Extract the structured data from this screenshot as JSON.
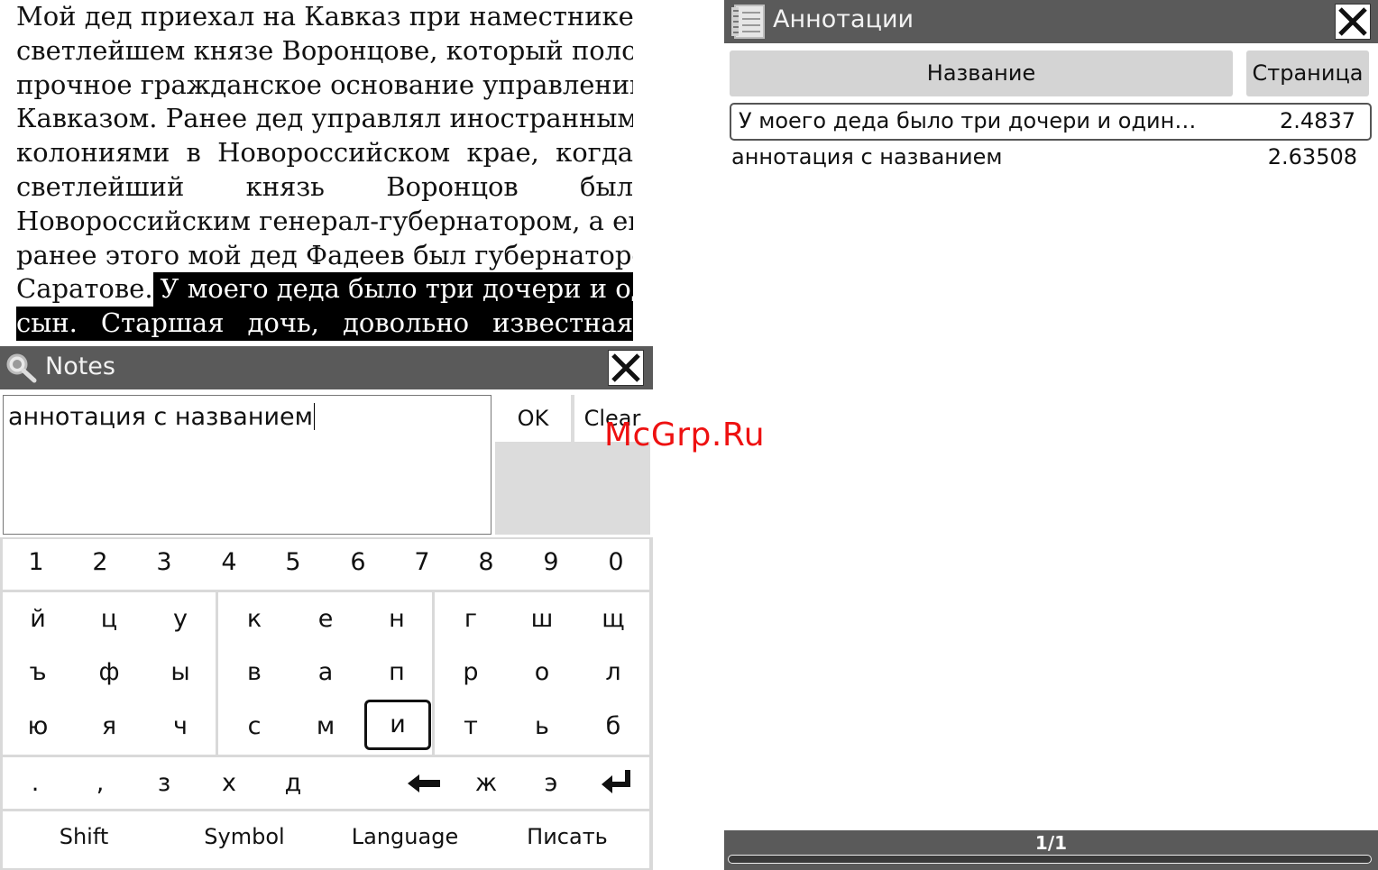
{
  "reader": {
    "lines": [
      "Мой дед приехал на Кавказ при наместнике",
      "светлейшем князе Воронцове, который положил",
      "прочное гражданское основание управлению",
      "Кавказом. Ранее дед управлял иностранными",
      "колониями в Новороссийском крае, когда",
      "светлейший князь Воронцов был",
      "Новороссийским генерал-губернатором, а еще",
      "ранее этого мой дед Фадеев был губернатором в"
    ],
    "line9_plain": "Саратове.",
    "line9_highlight": "У моего деда было три дочери и один",
    "line10_highlight": "сын. Старшая дочь, довольно известная"
  },
  "notes": {
    "title": "Notes",
    "icon": "magnifier-icon",
    "close_icon": "close-icon",
    "text": "аннотация с названием",
    "ok_label": "OK",
    "clear_label": "Clear"
  },
  "keyboard": {
    "digits": [
      "1",
      "2",
      "3",
      "4",
      "5",
      "6",
      "7",
      "8",
      "9",
      "0"
    ],
    "row1": [
      "й",
      "ц",
      "у",
      "к",
      "е",
      "н",
      "г",
      "ш",
      "щ"
    ],
    "row2": [
      "ъ",
      "ф",
      "ы",
      "в",
      "а",
      "п",
      "р",
      "о",
      "л"
    ],
    "row3": [
      "ю",
      "я",
      "ч",
      "с",
      "м",
      "и",
      "т",
      "ь",
      "б"
    ],
    "row4": [
      ".",
      ",",
      "з",
      "х",
      "д",
      "",
      "ж",
      "э",
      ""
    ],
    "backspace_icon": "backspace-arrow-icon",
    "enter_icon": "enter-icon",
    "selected_key": "и",
    "bottom": [
      "Shift",
      "Symbol",
      "Language",
      "Писать"
    ]
  },
  "annotations": {
    "title": "Аннотации",
    "icon": "notebook-icon",
    "close_icon": "close-icon",
    "col_name": "Название",
    "col_page": "Страница",
    "rows": [
      {
        "name": "У моего деда было три дочери и один…",
        "page": "2.4837"
      },
      {
        "name": "аннотация с названием",
        "page": "2.63508"
      }
    ],
    "pagination": "1/1"
  },
  "watermark": "McGrp.Ru"
}
